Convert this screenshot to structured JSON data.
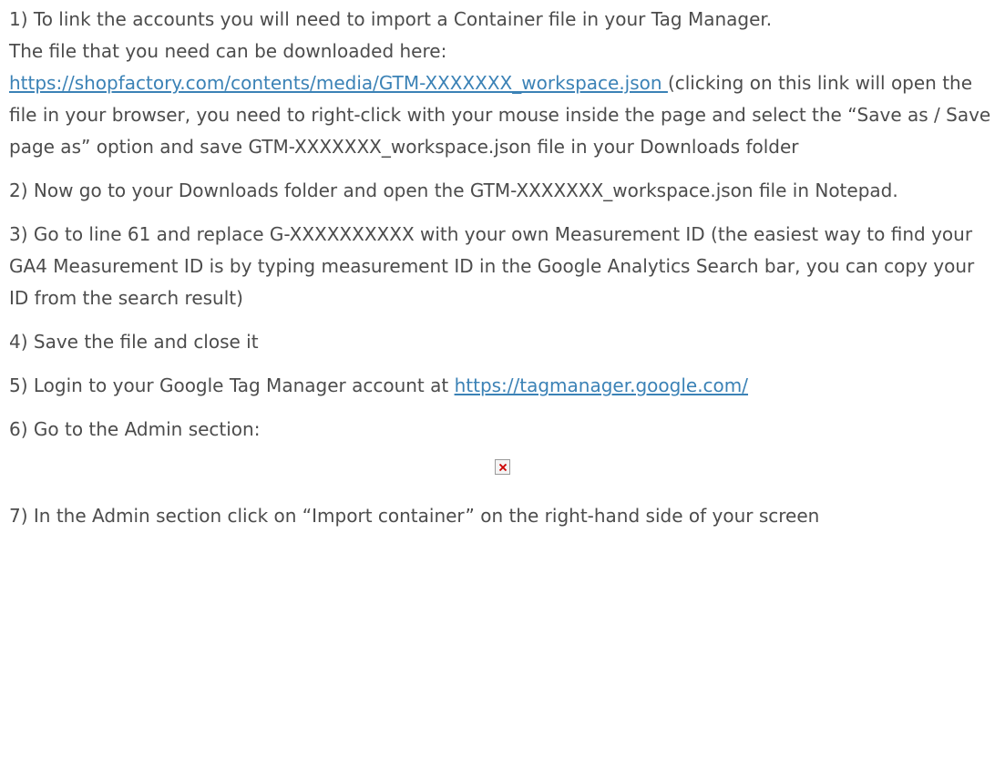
{
  "steps": {
    "s1_line1": "1) To link the accounts you will need to import a Container file in your Tag Manager.",
    "s1_line2": "The file that you need can be downloaded here:",
    "s1_link": "https://shopfactory.com/contents/media/GTM-XXXXXXX_workspace.json ",
    "s1_after_link": "(clicking on this link will open the file in your browser, you need to right-click with your mouse inside the page and select the “Save as / Save page as” option and save GTM-XXXXXXX_workspace.json file in your Downloads folder",
    "s2": "2) Now go to your Downloads folder and open the GTM-XXXXXXX_workspace.json file in Notepad.",
    "s3": "3) Go to line 61 and replace G-XXXXXXXXXX with your own Measurement ID (the easiest way to find your GA4 Measurement ID is by typing measurement ID in the Google Analytics Search bar, you can copy your ID from the search result)",
    "s4": "4) Save the file and close it",
    "s5_text": "5) Login to your Google Tag Manager account at ",
    "s5_link": "https://tagmanager.google.com/",
    "s6": "6) Go to the Admin section:",
    "s7": "7) In the Admin section click on “Import container” on the right-hand side of your screen"
  },
  "icons": {
    "broken_image": "broken-image-icon"
  },
  "colors": {
    "text": "#4c4c4c",
    "link": "#3b82b6",
    "broken_x": "#cc0000"
  }
}
